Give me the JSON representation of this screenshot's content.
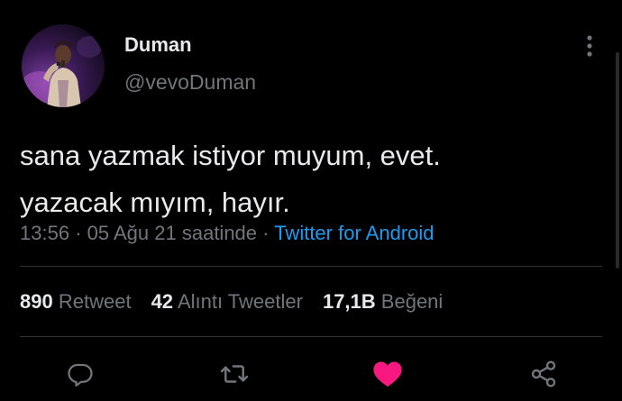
{
  "author": {
    "display_name": "Duman",
    "handle": "@vevoDuman"
  },
  "tweet": {
    "line1": "sana yazmak istiyor muyum, evet.",
    "line2": "yazacak mıyım, hayır.",
    "time": "13:56",
    "date": "05 Ağu 21 saatinde",
    "separator": "·",
    "source": "Twitter for Android"
  },
  "stats": {
    "retweet_count": "890",
    "retweet_label": "Retweet",
    "quote_count": "42",
    "quote_label": "Alıntı Tweetler",
    "like_count": "17,1B",
    "like_label": "Beğeni"
  },
  "actions": [
    {
      "icon": "reply-icon"
    },
    {
      "icon": "retweet-icon"
    },
    {
      "icon": "like-icon",
      "active": true
    },
    {
      "icon": "share-icon"
    }
  ],
  "colors": {
    "background": "#000000",
    "primary_text": "#e7e9ea",
    "secondary_text": "#71767b",
    "link": "#1d9bf0",
    "like": "#f91880",
    "divider": "#2f3336"
  }
}
